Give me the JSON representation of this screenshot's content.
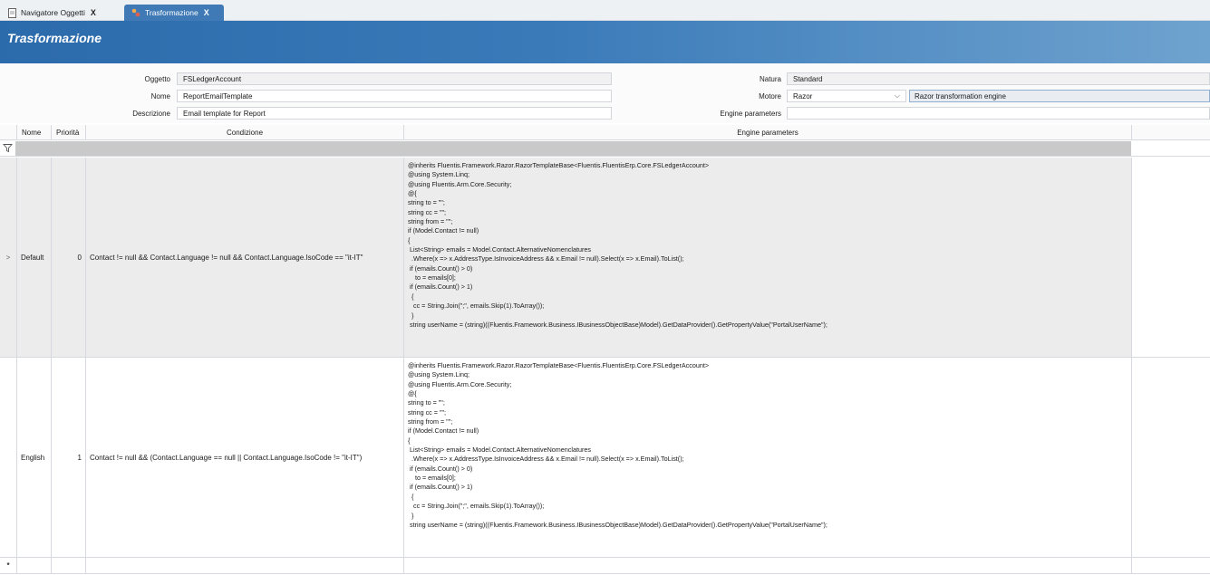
{
  "tabs": [
    {
      "label": "Navigatore Oggetti",
      "close": "X"
    },
    {
      "label": "Trasformazione",
      "close": "X"
    }
  ],
  "header": {
    "title": "Trasformazione"
  },
  "form": {
    "oggetto_label": "Oggetto",
    "oggetto_value": "FSLedgerAccount",
    "nome_label": "Nome",
    "nome_value": "ReportEmailTemplate",
    "descrizione_label": "Descrizione",
    "descrizione_value": "Email template for Report",
    "natura_label": "Natura",
    "natura_value": "Standard",
    "motore_label": "Motore",
    "motore_value": "Razor",
    "motore_description": "Razor transformation engine",
    "engine_parameters_label": "Engine parameters",
    "engine_parameters_value": ""
  },
  "grid": {
    "columns": [
      "Nome",
      "Priorità",
      "Condizione",
      "Engine parameters"
    ],
    "rows": [
      {
        "expander": ">",
        "nome": "Default",
        "priorita": "0",
        "condizione": "Contact != null && Contact.Language != null && Contact.Language.IsoCode == \"it-IT\"",
        "engine_parameters": "@inherits Fluentis.Framework.Razor.RazorTemplateBase<Fluentis.FluentisErp.Core.FSLedgerAccount>\n@using System.Linq;\n@using Fluentis.Arm.Core.Security;\n@{\nstring to = \"\";\nstring cc = \"\";\nstring from = \"\";\nif (Model.Contact != null)\n{\n List<String> emails = Model.Contact.AlternativeNomenclatures\n  .Where(x => x.AddressType.IsInvoiceAddress && x.Email != null).Select(x => x.Email).ToList();\n if (emails.Count() > 0)\n    to = emails[0];\n if (emails.Count() > 1)\n  {\n   cc = String.Join(\";\", emails.Skip(1).ToArray());\n  }\n string userName = (string)((Fluentis.Framework.Business.IBusinessObjectBase)Model).GetDataProvider().GetPropertyValue(\"PortalUserName\");"
      },
      {
        "expander": "",
        "nome": "English",
        "priorita": "1",
        "condizione": "Contact != null && (Contact.Language == null || Contact.Language.IsoCode != \"it-IT\")",
        "engine_parameters": "@inherits Fluentis.Framework.Razor.RazorTemplateBase<Fluentis.FluentisErp.Core.FSLedgerAccount>\n@using System.Linq;\n@using Fluentis.Arm.Core.Security;\n@{\nstring to = \"\";\nstring cc = \"\";\nstring from = \"\";\nif (Model.Contact != null)\n{\n List<String> emails = Model.Contact.AlternativeNomenclatures\n  .Where(x => x.AddressType.IsInvoiceAddress && x.Email != null).Select(x => x.Email).ToList();\n if (emails.Count() > 0)\n    to = emails[0];\n if (emails.Count() > 1)\n  {\n   cc = String.Join(\";\", emails.Skip(1).ToArray());\n  }\n string userName = (string)((Fluentis.Framework.Business.IBusinessObjectBase)Model).GetDataProvider().GetPropertyValue(\"PortalUserName\");"
      }
    ],
    "new_row_marker": "*"
  }
}
